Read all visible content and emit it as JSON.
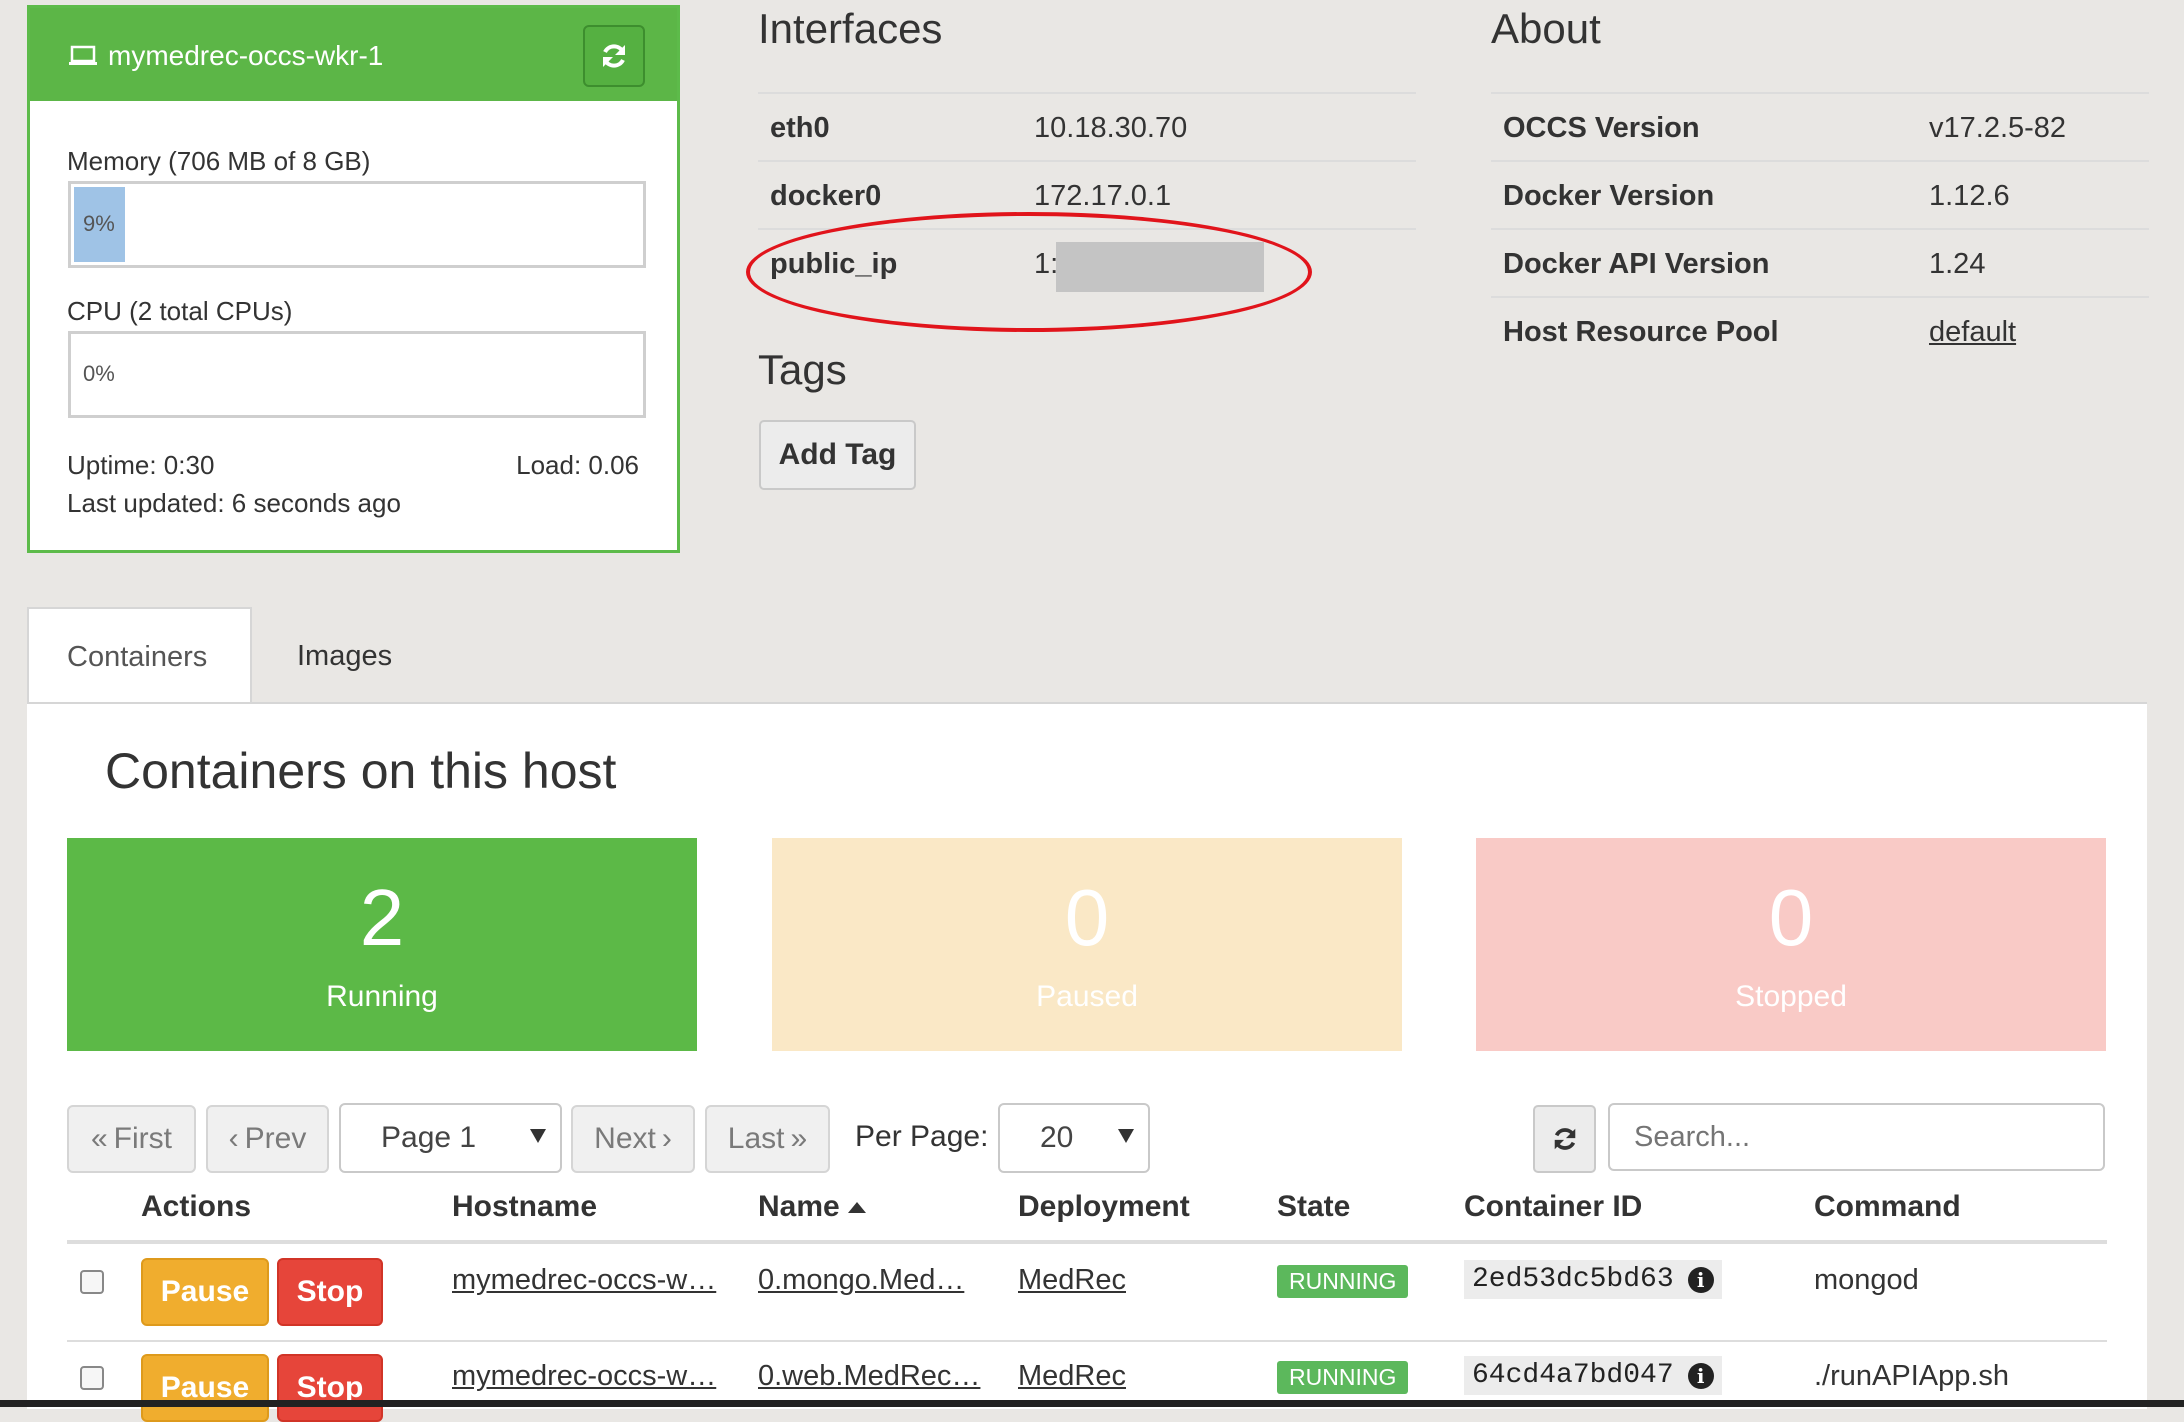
{
  "host": {
    "name": "mymedrec-occs-wkr-1",
    "memory_label": "Memory (706 MB of 8 GB)",
    "memory_percent_text": "9%",
    "memory_fraction": 0.09,
    "cpu_label": "CPU (2 total CPUs)",
    "cpu_percent_text": "0%",
    "cpu_fraction": 0.0,
    "uptime": "Uptime: 0:30",
    "load": "Load: 0.06",
    "last_updated": "Last updated: 6 seconds ago"
  },
  "interfaces": {
    "title": "Interfaces",
    "rows": [
      {
        "key": "eth0",
        "value": "10.18.30.70"
      },
      {
        "key": "docker0",
        "value": "172.17.0.1"
      },
      {
        "key": "public_ip",
        "value": "1:"
      }
    ]
  },
  "tags": {
    "title": "Tags",
    "add_label": "Add Tag"
  },
  "about": {
    "title": "About",
    "rows": [
      {
        "key": "OCCS Version",
        "value": "v17.2.5-82"
      },
      {
        "key": "Docker Version",
        "value": "1.12.6"
      },
      {
        "key": "Docker API Version",
        "value": "1.24"
      },
      {
        "key": "Host Resource Pool",
        "value": "default"
      }
    ]
  },
  "tabs": [
    {
      "label": "Containers",
      "active": true
    },
    {
      "label": "Images",
      "active": false
    }
  ],
  "containers": {
    "heading": "Containers on this host",
    "stats": [
      {
        "count": "2",
        "label": "Running",
        "color": "#5cb947"
      },
      {
        "count": "0",
        "label": "Paused",
        "color": "#fae8c6"
      },
      {
        "count": "0",
        "label": "Stopped",
        "color": "#f9cac6"
      }
    ],
    "pagination": {
      "first": "First",
      "prev": "Prev",
      "page": "Page 1",
      "next": "Next",
      "last": "Last",
      "per_page_label": "Per Page:",
      "per_page": "20",
      "search_placeholder": "Search..."
    },
    "columns": [
      "Actions",
      "Hostname",
      "Name",
      "Deployment",
      "State",
      "Container ID",
      "Command"
    ],
    "rows": [
      {
        "pause": "Pause",
        "stop": "Stop",
        "hostname": "mymedrec-occs-w…",
        "name": "0.mongo.Med…",
        "deployment": "MedRec",
        "state": "RUNNING",
        "container_id": "2ed53dc5bd63",
        "command": "mongod"
      },
      {
        "pause": "Pause",
        "stop": "Stop",
        "hostname": "mymedrec-occs-w…",
        "name": "0.web.MedRec…",
        "deployment": "MedRec",
        "state": "RUNNING",
        "container_id": "64cd4a7bd047",
        "command": "./runAPIApp.sh"
      }
    ]
  },
  "colors": {
    "accent_green": "#5cb647",
    "annotation_red": "#e1141b"
  }
}
